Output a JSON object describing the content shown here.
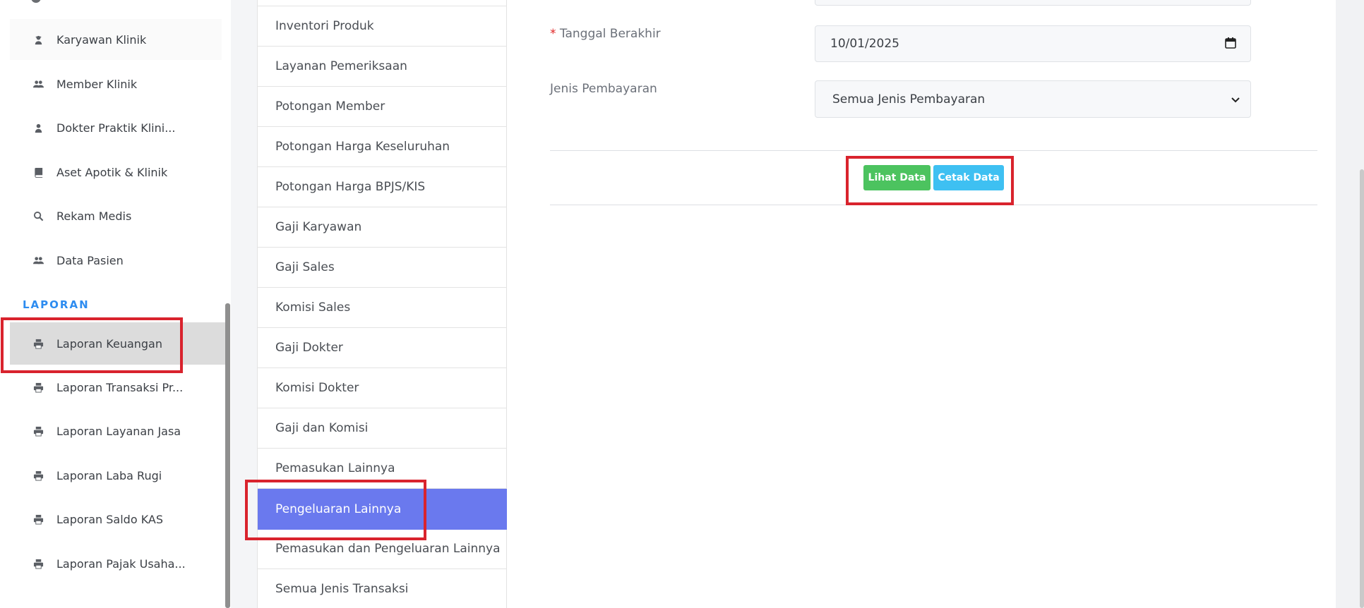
{
  "sidebar": {
    "items": [
      {
        "label": "Karyawan Klinik",
        "icon": "user-secret-icon"
      },
      {
        "label": "Member Klinik",
        "icon": "users-icon"
      },
      {
        "label": "Dokter Praktik Klini...",
        "icon": "user-icon"
      },
      {
        "label": "Aset Apotik & Klinik",
        "icon": "book-icon"
      },
      {
        "label": "Rekam Medis",
        "icon": "search-icon"
      },
      {
        "label": "Data Pasien",
        "icon": "users-icon"
      }
    ],
    "section_label": "LAPORAN",
    "report_items": [
      {
        "label": "Laporan Keuangan",
        "icon": "print-icon",
        "active": true
      },
      {
        "label": "Laporan Transaksi Pr...",
        "icon": "print-icon"
      },
      {
        "label": "Laporan Layanan Jasa",
        "icon": "print-icon"
      },
      {
        "label": "Laporan Laba Rugi",
        "icon": "print-icon"
      },
      {
        "label": "Laporan Saldo KAS",
        "icon": "print-icon"
      },
      {
        "label": "Laporan Pajak Usaha...",
        "icon": "print-icon"
      }
    ]
  },
  "report_types": [
    "Inventori Produk",
    "Layanan Pemeriksaan",
    "Potongan Member",
    "Potongan Harga Keseluruhan",
    "Potongan Harga BPJS/KIS",
    "Gaji Karyawan",
    "Gaji Sales",
    "Komisi Sales",
    "Gaji Dokter",
    "Komisi Dokter",
    "Gaji dan Komisi",
    "Pemasukan Lainnya",
    "Pengeluaran Lainnya",
    "Pemasukan dan Pengeluaran Lainnya",
    "Semua Jenis Transaksi"
  ],
  "active_report_type": "Pengeluaran Lainnya",
  "form": {
    "end_date_required_mark": "*",
    "end_date_label": "Tanggal Berakhir",
    "end_date_value": "10/01/2025",
    "payment_type_label": "Jenis Pembayaran",
    "payment_type_value": "Semua Jenis Pembayaran",
    "view_button": "Lihat Data",
    "print_button": "Cetak Data"
  },
  "colors": {
    "accent_active": "#6a79ee",
    "section_label": "#2d8cf0",
    "button_green": "#4cc35f",
    "button_blue": "#3ec0f2",
    "highlight_box": "#d9232d"
  }
}
